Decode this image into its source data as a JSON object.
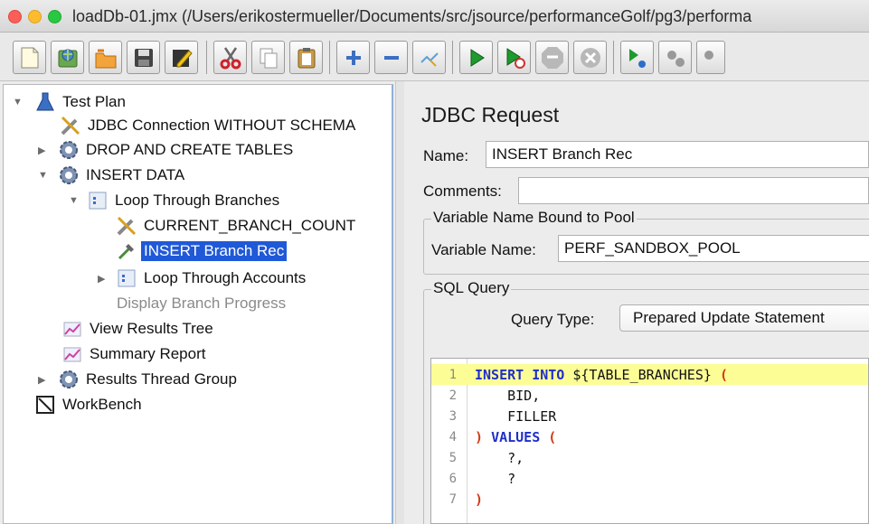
{
  "window": {
    "title": "loadDb-01.jmx (/Users/erikostermueller/Documents/src/jsource/performanceGolf/pg3/performa"
  },
  "toolbar": {
    "buttons": [
      {
        "icon": "new-file-icon"
      },
      {
        "icon": "templates-icon"
      },
      {
        "icon": "open-folder-icon"
      },
      {
        "icon": "save-icon"
      },
      {
        "icon": "save-as-icon"
      },
      {
        "icon": "cut-icon"
      },
      {
        "icon": "copy-icon"
      },
      {
        "icon": "paste-icon"
      },
      {
        "icon": "expand-plus-icon"
      },
      {
        "icon": "collapse-minus-icon"
      },
      {
        "icon": "toggle-icon"
      },
      {
        "icon": "start-icon"
      },
      {
        "icon": "start-no-pauses-icon"
      },
      {
        "icon": "stop-icon"
      },
      {
        "icon": "shutdown-icon"
      },
      {
        "icon": "remote-start-icon"
      },
      {
        "icon": "remote-stop-icon"
      }
    ]
  },
  "tree": {
    "nodes": [
      {
        "label": "Test Plan",
        "icon": "test-plan-flask-icon",
        "expanded": true
      },
      {
        "label": "JDBC Connection WITHOUT SCHEMA",
        "icon": "config-wrench-icon"
      },
      {
        "label": "DROP AND CREATE TABLES",
        "icon": "thread-group-gear-icon",
        "expanded": false
      },
      {
        "label": "INSERT DATA",
        "icon": "thread-group-gear-icon",
        "expanded": true
      },
      {
        "label": "Loop Through Branches",
        "icon": "loop-controller-icon",
        "expanded": true
      },
      {
        "label": "CURRENT_BRANCH_COUNT",
        "icon": "config-wrench-icon"
      },
      {
        "label": "INSERT Branch Rec",
        "icon": "sampler-pipette-icon",
        "selected": true
      },
      {
        "label": "Loop Through Accounts",
        "icon": "loop-controller-icon",
        "expanded": false
      },
      {
        "label": "Display Branch Progress",
        "icon": "none",
        "disabled": true
      },
      {
        "label": "View Results Tree",
        "icon": "listener-graph-icon"
      },
      {
        "label": "Summary Report",
        "icon": "listener-graph-icon"
      },
      {
        "label": "Results Thread Group",
        "icon": "thread-group-gear-icon",
        "expanded": false
      },
      {
        "label": "WorkBench",
        "icon": "workbench-icon"
      }
    ]
  },
  "panel": {
    "title": "JDBC Request",
    "name_label": "Name:",
    "name_value": "INSERT Branch Rec",
    "comments_label": "Comments:",
    "comments_value": "",
    "pool_group_title": "Variable Name Bound to Pool",
    "variable_name_label": "Variable Name:",
    "variable_name_value": "PERF_SANDBOX_POOL",
    "sql_group_title": "SQL Query",
    "query_type_label": "Query Type:",
    "query_type_value": "Prepared Update Statement"
  },
  "editor": {
    "lines": [
      {
        "num": "1",
        "text": "INSERT INTO ${TABLE_BRANCHES} (",
        "highlight": true
      },
      {
        "num": "2",
        "text": "    BID,"
      },
      {
        "num": "3",
        "text": "    FILLER"
      },
      {
        "num": "4",
        "text": ") VALUES ("
      },
      {
        "num": "5",
        "text": "    ?,"
      },
      {
        "num": "6",
        "text": "    ?"
      },
      {
        "num": "7",
        "text": ")"
      }
    ],
    "colors": {
      "keyword": "#1f2fc9",
      "paren": "#d33a14",
      "highlight": "#fdfd96"
    }
  },
  "colors": {
    "selection": "#1f59d8"
  }
}
